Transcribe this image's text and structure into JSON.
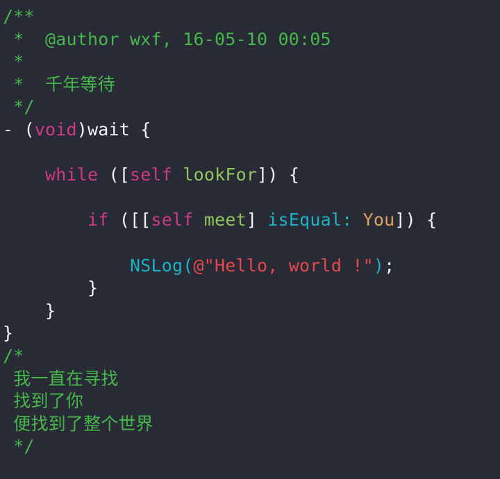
{
  "editor": {
    "language": "Objective-C",
    "background_color": "#282a36",
    "palette": {
      "comment": "#46b74a",
      "plain": "#f2f2f2",
      "keyword": "#cf3a84",
      "method": "#8ec65a",
      "selector": "#1bb3c4",
      "class": "#e0a25c",
      "function": "#1bb3c4",
      "string": "#e4484d"
    }
  },
  "lines": [
    {
      "id": "line-1",
      "tokens": [
        {
          "text": "/**",
          "type": "comment"
        }
      ]
    },
    {
      "id": "line-2",
      "tokens": [
        {
          "text": " *  @author wxf, 16-05-10 00:05",
          "type": "comment"
        }
      ]
    },
    {
      "id": "line-3",
      "tokens": [
        {
          "text": " *",
          "type": "comment"
        }
      ]
    },
    {
      "id": "line-4",
      "tokens": [
        {
          "text": " *  ",
          "type": "comment"
        },
        {
          "text": "千年等待",
          "type": "comment",
          "cjk": true
        }
      ]
    },
    {
      "id": "line-5",
      "tokens": [
        {
          "text": " */",
          "type": "comment"
        }
      ]
    },
    {
      "id": "line-6",
      "tokens": [
        {
          "text": "- (",
          "type": "plain"
        },
        {
          "text": "void",
          "type": "keyword"
        },
        {
          "text": ")wait {",
          "type": "plain"
        }
      ]
    },
    {
      "id": "line-7",
      "tokens": [
        {
          "text": "",
          "type": "plain"
        }
      ]
    },
    {
      "id": "line-8",
      "tokens": [
        {
          "text": "    ",
          "type": "plain"
        },
        {
          "text": "while",
          "type": "keyword"
        },
        {
          "text": " ([",
          "type": "plain"
        },
        {
          "text": "self",
          "type": "keyword"
        },
        {
          "text": " ",
          "type": "plain"
        },
        {
          "text": "lookFor",
          "type": "method"
        },
        {
          "text": "]) {",
          "type": "plain"
        }
      ]
    },
    {
      "id": "line-9",
      "tokens": [
        {
          "text": "",
          "type": "plain"
        }
      ]
    },
    {
      "id": "line-10",
      "tokens": [
        {
          "text": "        ",
          "type": "plain"
        },
        {
          "text": "if",
          "type": "keyword"
        },
        {
          "text": " ([[",
          "type": "plain"
        },
        {
          "text": "self",
          "type": "keyword"
        },
        {
          "text": " ",
          "type": "plain"
        },
        {
          "text": "meet",
          "type": "method"
        },
        {
          "text": "] ",
          "type": "plain"
        },
        {
          "text": "isEqual:",
          "type": "selector"
        },
        {
          "text": " ",
          "type": "plain"
        },
        {
          "text": "You",
          "type": "class"
        },
        {
          "text": "]) {",
          "type": "plain"
        }
      ]
    },
    {
      "id": "line-11",
      "tokens": [
        {
          "text": "",
          "type": "plain"
        }
      ]
    },
    {
      "id": "line-12",
      "tokens": [
        {
          "text": "            ",
          "type": "plain"
        },
        {
          "text": "NSLog",
          "type": "function"
        },
        {
          "text": "(",
          "type": "function"
        },
        {
          "text": "@\"Hello, world !\"",
          "type": "string"
        },
        {
          "text": ")",
          "type": "function"
        },
        {
          "text": ";",
          "type": "plain"
        }
      ]
    },
    {
      "id": "line-13",
      "tokens": [
        {
          "text": "        }",
          "type": "plain"
        }
      ]
    },
    {
      "id": "line-14",
      "tokens": [
        {
          "text": "    }",
          "type": "plain"
        }
      ]
    },
    {
      "id": "line-15",
      "tokens": [
        {
          "text": "}",
          "type": "plain"
        }
      ]
    },
    {
      "id": "line-16",
      "tokens": [
        {
          "text": "/*",
          "type": "comment"
        }
      ]
    },
    {
      "id": "line-17",
      "tokens": [
        {
          "text": " ",
          "type": "comment"
        },
        {
          "text": "我一直在寻找",
          "type": "comment",
          "cjk": true
        }
      ]
    },
    {
      "id": "line-18",
      "tokens": [
        {
          "text": " ",
          "type": "comment"
        },
        {
          "text": "找到了你",
          "type": "comment",
          "cjk": true
        }
      ]
    },
    {
      "id": "line-19",
      "tokens": [
        {
          "text": " ",
          "type": "comment"
        },
        {
          "text": "便找到了整个世界",
          "type": "comment",
          "cjk": true
        }
      ]
    },
    {
      "id": "line-20",
      "tokens": [
        {
          "text": " */",
          "type": "comment"
        }
      ]
    }
  ]
}
